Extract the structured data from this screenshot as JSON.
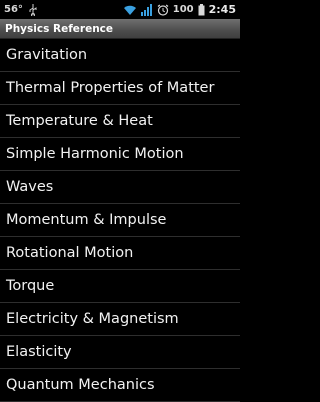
{
  "status_bar": {
    "temperature": "56°",
    "battery_percent": "100",
    "time": "2:45",
    "icons": [
      "usb-icon",
      "wifi-icon",
      "signal-icon",
      "alarm-icon",
      "battery-icon"
    ]
  },
  "title_bar": {
    "title": "Physics Reference"
  },
  "menu": {
    "items": [
      {
        "label": "Gravitation"
      },
      {
        "label": "Thermal Properties of Matter"
      },
      {
        "label": "Temperature & Heat"
      },
      {
        "label": "Simple Harmonic Motion"
      },
      {
        "label": "Waves"
      },
      {
        "label": "Momentum & Impulse"
      },
      {
        "label": "Rotational Motion"
      },
      {
        "label": "Torque"
      },
      {
        "label": "Electricity & Magnetism"
      },
      {
        "label": "Elasticity"
      },
      {
        "label": "Quantum Mechanics"
      }
    ]
  },
  "colors": {
    "background": "#000000",
    "title_bar": "#555555",
    "wifi_signal": "#3aa0e0",
    "divider": "#2e2e2e"
  }
}
